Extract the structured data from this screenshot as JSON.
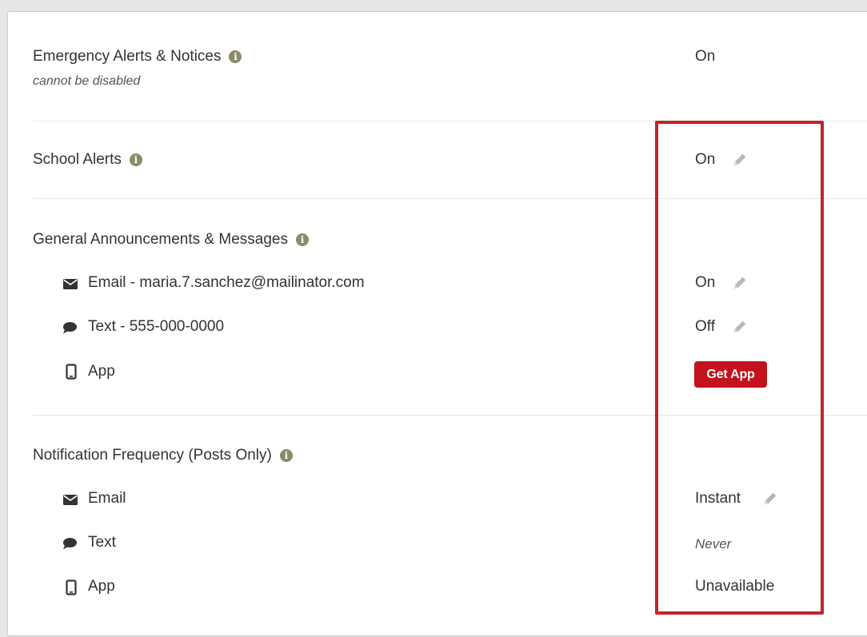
{
  "sections": {
    "emergency": {
      "label": "Emergency Alerts & Notices",
      "sublabel": "cannot be disabled",
      "value": "On"
    },
    "school": {
      "label": "School Alerts",
      "value": "On"
    },
    "general": {
      "label": "General Announcements & Messages",
      "email_label": "Email - maria.7.sanchez@mailinator.com",
      "email_value": "On",
      "text_label": "Text - 555-000-0000",
      "text_value": "Off",
      "app_label": "App",
      "get_app_label": "Get App"
    },
    "frequency": {
      "label": "Notification Frequency (Posts Only)",
      "email_label": "Email",
      "email_value": "Instant",
      "text_label": "Text",
      "text_value": "Never",
      "app_label": "App",
      "app_value": "Unavailable"
    }
  },
  "icons": {
    "info": "info-icon",
    "edit": "pencil-icon",
    "email": "envelope-icon",
    "text": "speech-bubble-icon",
    "app": "mobile-phone-icon"
  },
  "info_glyph": "i",
  "colors": {
    "info_icon": "#8c8a6a",
    "get_app_button": "#c4121c",
    "highlight_box": "#c3232b",
    "pencil": "#b5b5b5"
  }
}
